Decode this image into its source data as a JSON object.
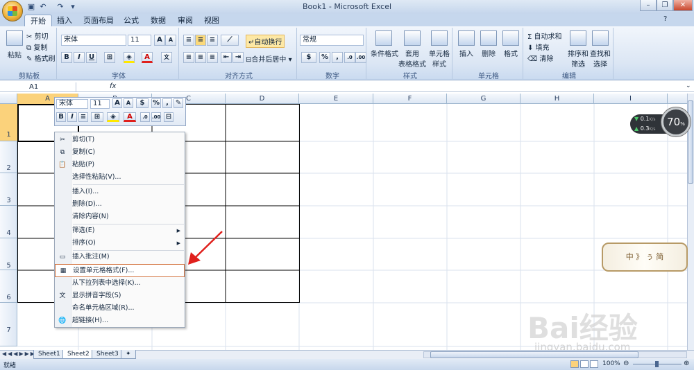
{
  "window": {
    "title": "Book1 - Microsoft Excel"
  },
  "tabs": [
    "开始",
    "插入",
    "页面布局",
    "公式",
    "数据",
    "审阅",
    "视图"
  ],
  "ribbon": {
    "clipboard": {
      "label": "剪贴板",
      "paste": "粘贴",
      "cut": "剪切",
      "copy": "复制",
      "format_painter": "格式刷"
    },
    "font": {
      "label": "字体",
      "name": "宋体",
      "size": "11"
    },
    "alignment": {
      "label": "对齐方式",
      "wrap": "自动换行",
      "merge": "合并后居中"
    },
    "number": {
      "label": "数字",
      "format": "常规"
    },
    "styles": {
      "label": "样式",
      "conditional": [
        "条件格式"
      ],
      "table": [
        "套用",
        "表格格式"
      ],
      "cell": [
        "单元格",
        "样式"
      ]
    },
    "cells": {
      "label": "单元格",
      "insert": "插入",
      "delete": "删除",
      "format": "格式"
    },
    "editing": {
      "label": "编辑",
      "autosum": "自动求和",
      "fill": "填充",
      "clear": "清除",
      "sort": [
        "排序和",
        "筛选"
      ],
      "find": [
        "查找和",
        "选择"
      ]
    }
  },
  "formula_bar": {
    "name_box": "A1",
    "fx": "fx"
  },
  "columns": [
    "A",
    "B",
    "C",
    "D",
    "E",
    "F",
    "G",
    "H",
    "I"
  ],
  "rows": [
    "1",
    "2",
    "3",
    "4",
    "5",
    "6",
    "7"
  ],
  "mini_toolbar": {
    "font": "宋体",
    "size": "11"
  },
  "context_menu": [
    {
      "label": "剪切(T)",
      "icon": "✂"
    },
    {
      "label": "复制(C)",
      "icon": "⧉"
    },
    {
      "label": "粘贴(P)",
      "icon": "📋"
    },
    {
      "label": "选择性粘贴(V)...",
      "icon": ""
    },
    {
      "sep": true
    },
    {
      "label": "插入(I)...",
      "icon": ""
    },
    {
      "label": "删除(D)...",
      "icon": ""
    },
    {
      "label": "清除内容(N)",
      "icon": ""
    },
    {
      "sep": true
    },
    {
      "label": "筛选(E)",
      "icon": "",
      "submenu": true
    },
    {
      "label": "排序(O)",
      "icon": "",
      "submenu": true
    },
    {
      "sep": true
    },
    {
      "label": "插入批注(M)",
      "icon": "▭"
    },
    {
      "label": "设置单元格格式(F)...",
      "icon": "▦",
      "highlight": true
    },
    {
      "label": "从下拉列表中选择(K)...",
      "icon": ""
    },
    {
      "label": "显示拼音字段(S)",
      "icon": "文"
    },
    {
      "label": "命名单元格区域(R)...",
      "icon": ""
    },
    {
      "label": "超链接(H)...",
      "icon": "🌐"
    }
  ],
  "sheets": [
    "Sheet1",
    "Sheet2",
    "Sheet3"
  ],
  "active_sheet": 1,
  "status": {
    "mode": "就绪",
    "zoom": "100%"
  },
  "network": {
    "down": "0.1",
    "up": "0.3",
    "unit": "K/s",
    "percent": "70",
    "pct_sign": "%"
  },
  "deco_text": "中 》 ぅ 简",
  "watermark": {
    "brand": "Bai经验",
    "url": "jingyan.baidu.com"
  }
}
